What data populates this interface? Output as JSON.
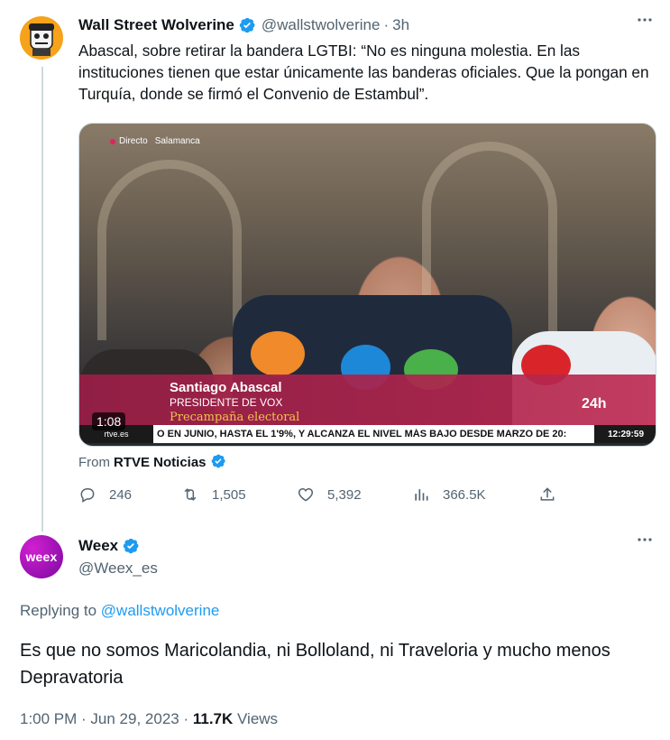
{
  "tweet": {
    "author_name": "Wall Street Wolverine",
    "author_handle": "@wallstwolverine",
    "separator": "·",
    "time": "3h",
    "text": "Abascal, sobre retirar la bandera LGTBI: “No es ninguna molestia. En las instituciones tienen que estar únicamente las banderas oficiales. Que la pongan en Turquía, donde se firmó el Convenio de Estambul”.",
    "more_icon": "more-dots-icon",
    "video": {
      "live_label": "Directo",
      "location": "Salamanca",
      "lower_third_name": "Santiago Abascal",
      "lower_third_role": "PRESIDENTE DE VOX",
      "lower_third_tag": "Precampaña electoral",
      "channel": "24h",
      "ticker_logo": "rtve.es",
      "ticker_text": "O EN JUNIO, HASTA EL 1'9%, Y ALCANZA EL NIVEL MÁS BAJO DESDE MARZO DE 20:",
      "ticker_clock": "12:29:59",
      "duration": "1:08"
    },
    "from_label": "From",
    "from_source": "RTVE Noticias",
    "actions": {
      "replies": "246",
      "retweets": "1,505",
      "likes": "5,392",
      "views": "366.5K"
    }
  },
  "reply": {
    "avatar_text": "weex",
    "author_name": "Weex",
    "author_handle": "@Weex_es",
    "replying_label": "Replying to",
    "replying_to": "@wallstwolverine",
    "text": "Es que no somos Maricolandia, ni Bolloland, ni Traveloria y mucho menos Depravatoria",
    "time": "1:00 PM · Jun 29, 2023 · ",
    "views_count": "11.7K",
    "views_label": " Views"
  },
  "colors": {
    "accent": "#1d9bf0",
    "muted": "#536471",
    "text": "#0f1419"
  }
}
